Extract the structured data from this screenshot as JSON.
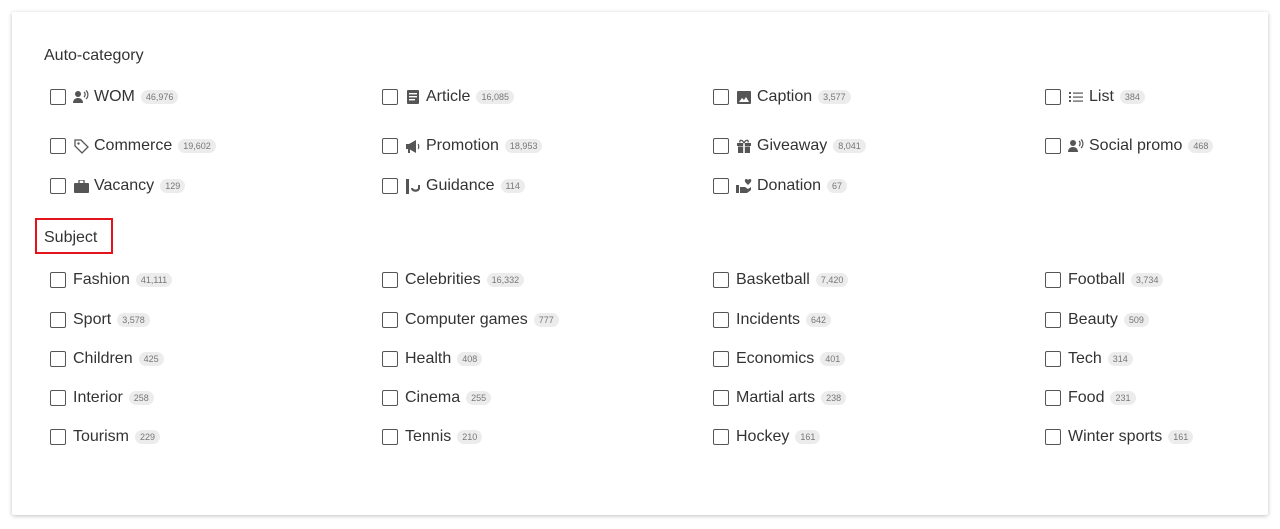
{
  "auto_category": {
    "title": "Auto-category",
    "items": [
      {
        "label": "WOM",
        "count": "46,976",
        "icon": "social-voice-icon"
      },
      {
        "label": "Article",
        "count": "16,085",
        "icon": "article-icon"
      },
      {
        "label": "Caption",
        "count": "3,577",
        "icon": "image-icon"
      },
      {
        "label": "List",
        "count": "384",
        "icon": "list-icon"
      },
      {
        "label": "Commerce",
        "count": "19,602",
        "icon": "tag-icon"
      },
      {
        "label": "Promotion",
        "count": "18,953",
        "icon": "megaphone-icon"
      },
      {
        "label": "Giveaway",
        "count": "8,041",
        "icon": "gift-icon"
      },
      {
        "label": "Social promo",
        "count": "468",
        "icon": "social-voice-icon"
      },
      {
        "label": "Vacancy",
        "count": "129",
        "icon": "briefcase-icon"
      },
      {
        "label": "Guidance",
        "count": "114",
        "icon": "guidance-icon"
      },
      {
        "label": "Donation",
        "count": "67",
        "icon": "donation-icon"
      }
    ]
  },
  "subject": {
    "title": "Subject",
    "items": [
      {
        "label": "Fashion",
        "count": "41,111"
      },
      {
        "label": "Celebrities",
        "count": "16,332"
      },
      {
        "label": "Basketball",
        "count": "7,420"
      },
      {
        "label": "Football",
        "count": "3,734"
      },
      {
        "label": "Sport",
        "count": "3,578"
      },
      {
        "label": "Computer games",
        "count": "777"
      },
      {
        "label": "Incidents",
        "count": "642"
      },
      {
        "label": "Beauty",
        "count": "509"
      },
      {
        "label": "Children",
        "count": "425"
      },
      {
        "label": "Health",
        "count": "408"
      },
      {
        "label": "Economics",
        "count": "401"
      },
      {
        "label": "Tech",
        "count": "314"
      },
      {
        "label": "Interior",
        "count": "258"
      },
      {
        "label": "Cinema",
        "count": "255"
      },
      {
        "label": "Martial arts",
        "count": "238"
      },
      {
        "label": "Food",
        "count": "231"
      },
      {
        "label": "Tourism",
        "count": "229"
      },
      {
        "label": "Tennis",
        "count": "210"
      },
      {
        "label": "Hockey",
        "count": "161"
      },
      {
        "label": "Winter sports",
        "count": "161"
      }
    ]
  },
  "colors": {
    "highlight_border": "#e4131b",
    "badge_bg": "#ececec",
    "text": "#333333"
  }
}
